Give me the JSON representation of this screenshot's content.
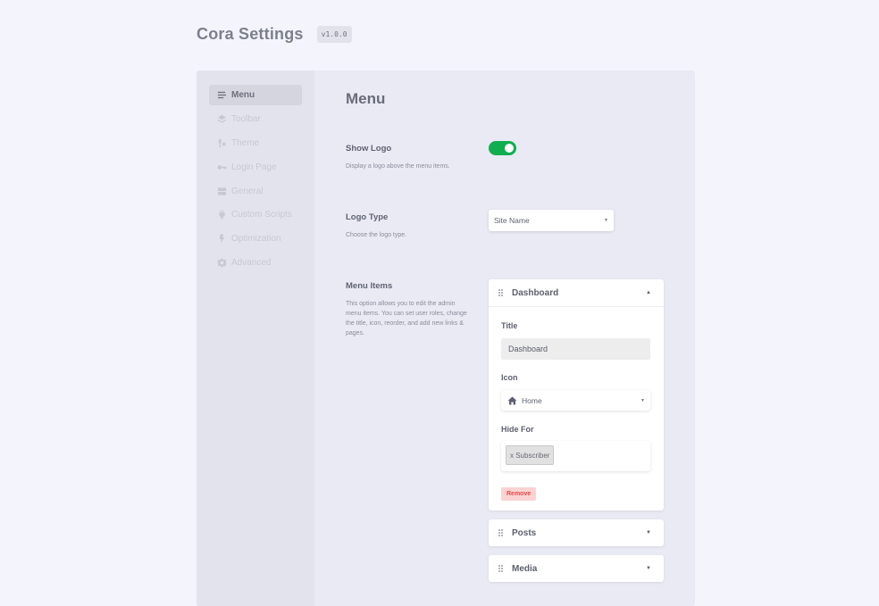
{
  "app": {
    "title": "Cora Settings",
    "version": "v1.0.0"
  },
  "sidebar": {
    "items": [
      {
        "label": "Menu",
        "icon": "menu-lines-icon",
        "active": true
      },
      {
        "label": "Toolbar",
        "icon": "layers-icon",
        "active": false
      },
      {
        "label": "Theme",
        "icon": "paint-icon",
        "active": false
      },
      {
        "label": "Login Page",
        "icon": "key-icon",
        "active": false
      },
      {
        "label": "General",
        "icon": "server-icon",
        "active": false
      },
      {
        "label": "Custom Scripts",
        "icon": "plug-icon",
        "active": false
      },
      {
        "label": "Optimization",
        "icon": "bolt-icon",
        "active": false
      },
      {
        "label": "Advanced",
        "icon": "gear-icon",
        "active": false
      }
    ]
  },
  "main": {
    "title": "Menu",
    "show_logo": {
      "label": "Show Logo",
      "description": "Display a logo above the menu items.",
      "enabled": true
    },
    "logo_type": {
      "label": "Logo Type",
      "description": "Choose the logo type.",
      "value": "Site Name"
    },
    "menu_items": {
      "label": "Menu Items",
      "description": "This option allows you to edit the admin menu items. You can set user roles, change the title, icon, reorder, and add new links & pages.",
      "items": [
        {
          "name": "Dashboard",
          "expanded": true,
          "title_label": "Title",
          "title_value": "Dashboard",
          "icon_label": "Icon",
          "icon_value": "Home",
          "hide_for_label": "Hide For",
          "hide_for_tags": [
            "x Subscriber"
          ],
          "remove_label": "Remove"
        },
        {
          "name": "Posts",
          "expanded": false
        },
        {
          "name": "Media",
          "expanded": false
        }
      ]
    }
  },
  "colors": {
    "toggle_on": "#0fae4f",
    "remove_bg": "#fbd3d3",
    "remove_text": "#e44a4a"
  }
}
